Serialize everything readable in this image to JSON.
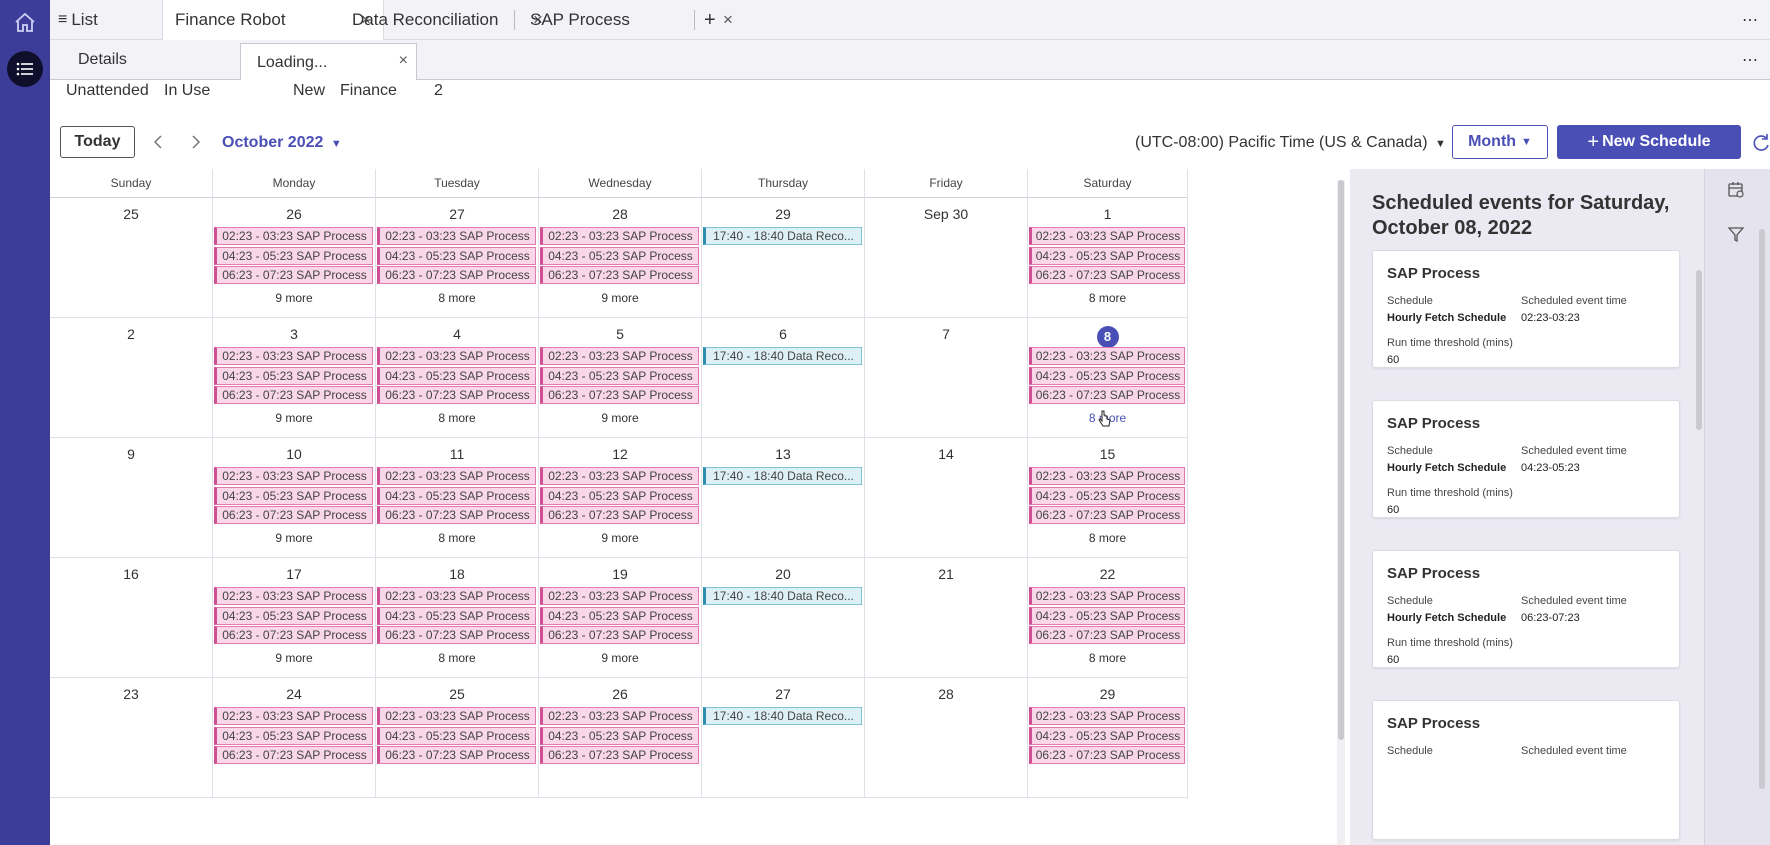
{
  "tabs": [
    {
      "label": "List"
    },
    {
      "label": "Finance Robot"
    },
    {
      "label": "Data Reconciliation"
    },
    {
      "label": "SAP Process"
    }
  ],
  "subtabs": [
    {
      "label": "Details"
    },
    {
      "label": "Loading..."
    }
  ],
  "info": [
    "Unattended",
    "In Use",
    "New",
    "Finance",
    "2"
  ],
  "toolbar": {
    "today": "Today",
    "month_label": "October 2022",
    "timezone": "(UTC-08:00) Pacific Time (US & Canada)",
    "view": "Month",
    "new_schedule": "New Schedule"
  },
  "calendar": {
    "days_of_week": [
      "Sunday",
      "Monday",
      "Tuesday",
      "Wednesday",
      "Thursday",
      "Friday",
      "Saturday"
    ],
    "weeks": [
      [
        "25",
        "26",
        "27",
        "28",
        "29",
        "Sep 30",
        "1"
      ],
      [
        "2",
        "3",
        "4",
        "5",
        "6",
        "7",
        "8"
      ],
      [
        "9",
        "10",
        "11",
        "12",
        "13",
        "14",
        "15"
      ],
      [
        "16",
        "17",
        "18",
        "19",
        "20",
        "21",
        "22"
      ],
      [
        "23",
        "24",
        "25",
        "26",
        "27",
        "28",
        "29"
      ]
    ],
    "selected_date": "8",
    "event_templates": {
      "sap": [
        "02:23 - 03:23 SAP Process",
        "04:23 - 05:23 SAP Process",
        "06:23 - 07:23 SAP Process"
      ],
      "data": [
        "17:40 - 18:40 Data Reco..."
      ]
    },
    "more_labels": [
      "9 more",
      "8 more",
      "9 more",
      "8 more"
    ],
    "colors": {
      "sap": "#f9d7e8",
      "data": "#dcf0f6",
      "accent": "#4a4fb6"
    }
  },
  "panel": {
    "title": "Scheduled events for Saturday, October 08, 2022",
    "cards": [
      {
        "title": "SAP Process",
        "schedule_label": "Schedule",
        "schedule": "Hourly Fetch Schedule",
        "time_label": "Scheduled event time",
        "time": "02:23-03:23",
        "threshold_label": "Run time threshold (mins)",
        "threshold": "60"
      },
      {
        "title": "SAP Process",
        "schedule_label": "Schedule",
        "schedule": "Hourly Fetch Schedule",
        "time_label": "Scheduled event time",
        "time": "04:23-05:23",
        "threshold_label": "Run time threshold (mins)",
        "threshold": "60"
      },
      {
        "title": "SAP Process",
        "schedule_label": "Schedule",
        "schedule": "Hourly Fetch Schedule",
        "time_label": "Scheduled event time",
        "time": "06:23-07:23",
        "threshold_label": "Run time threshold (mins)",
        "threshold": "60"
      },
      {
        "title": "SAP Process",
        "schedule_label": "Schedule",
        "schedule": "",
        "time_label": "Scheduled event time",
        "time": "",
        "threshold_label": "",
        "threshold": ""
      }
    ]
  },
  "icons": [
    "home-icon",
    "list-menu-icon",
    "hamburger-icon",
    "close-icon",
    "plus-icon",
    "more-icon",
    "chevron-left-icon",
    "chevron-right-icon",
    "caret-down-icon",
    "refresh-icon",
    "calendar-icon",
    "filter-icon",
    "cursor-icon"
  ]
}
